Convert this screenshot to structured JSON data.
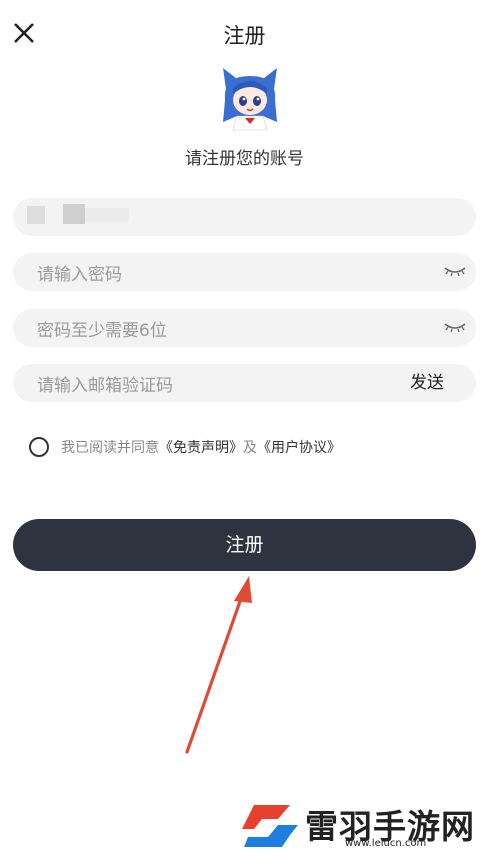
{
  "header": {
    "title": "注册",
    "close_icon": "close-icon"
  },
  "subtitle": "请注册您的账号",
  "form": {
    "account_value": "",
    "password_placeholder": "请输入密码",
    "password_hint_placeholder": "密码至少需要6位",
    "email_code_placeholder": "请输入邮箱验证码",
    "send_label": "发送",
    "eye_icon": "eye-closed-icon"
  },
  "agreement": {
    "prefix": "我已阅读并同意",
    "disclaimer_link": "《免责声明》",
    "connector": "及",
    "user_agreement_link": "《用户协议》"
  },
  "submit_label": "注册",
  "watermark": {
    "name": "雷羽手游网",
    "url": "www.leiucn.com"
  },
  "colors": {
    "button_bg": "#2d3440",
    "field_bg": "#f3f3f3",
    "arrow": "#e04a35",
    "logo_red": "#e8402e",
    "logo_blue": "#1f7fe0"
  }
}
